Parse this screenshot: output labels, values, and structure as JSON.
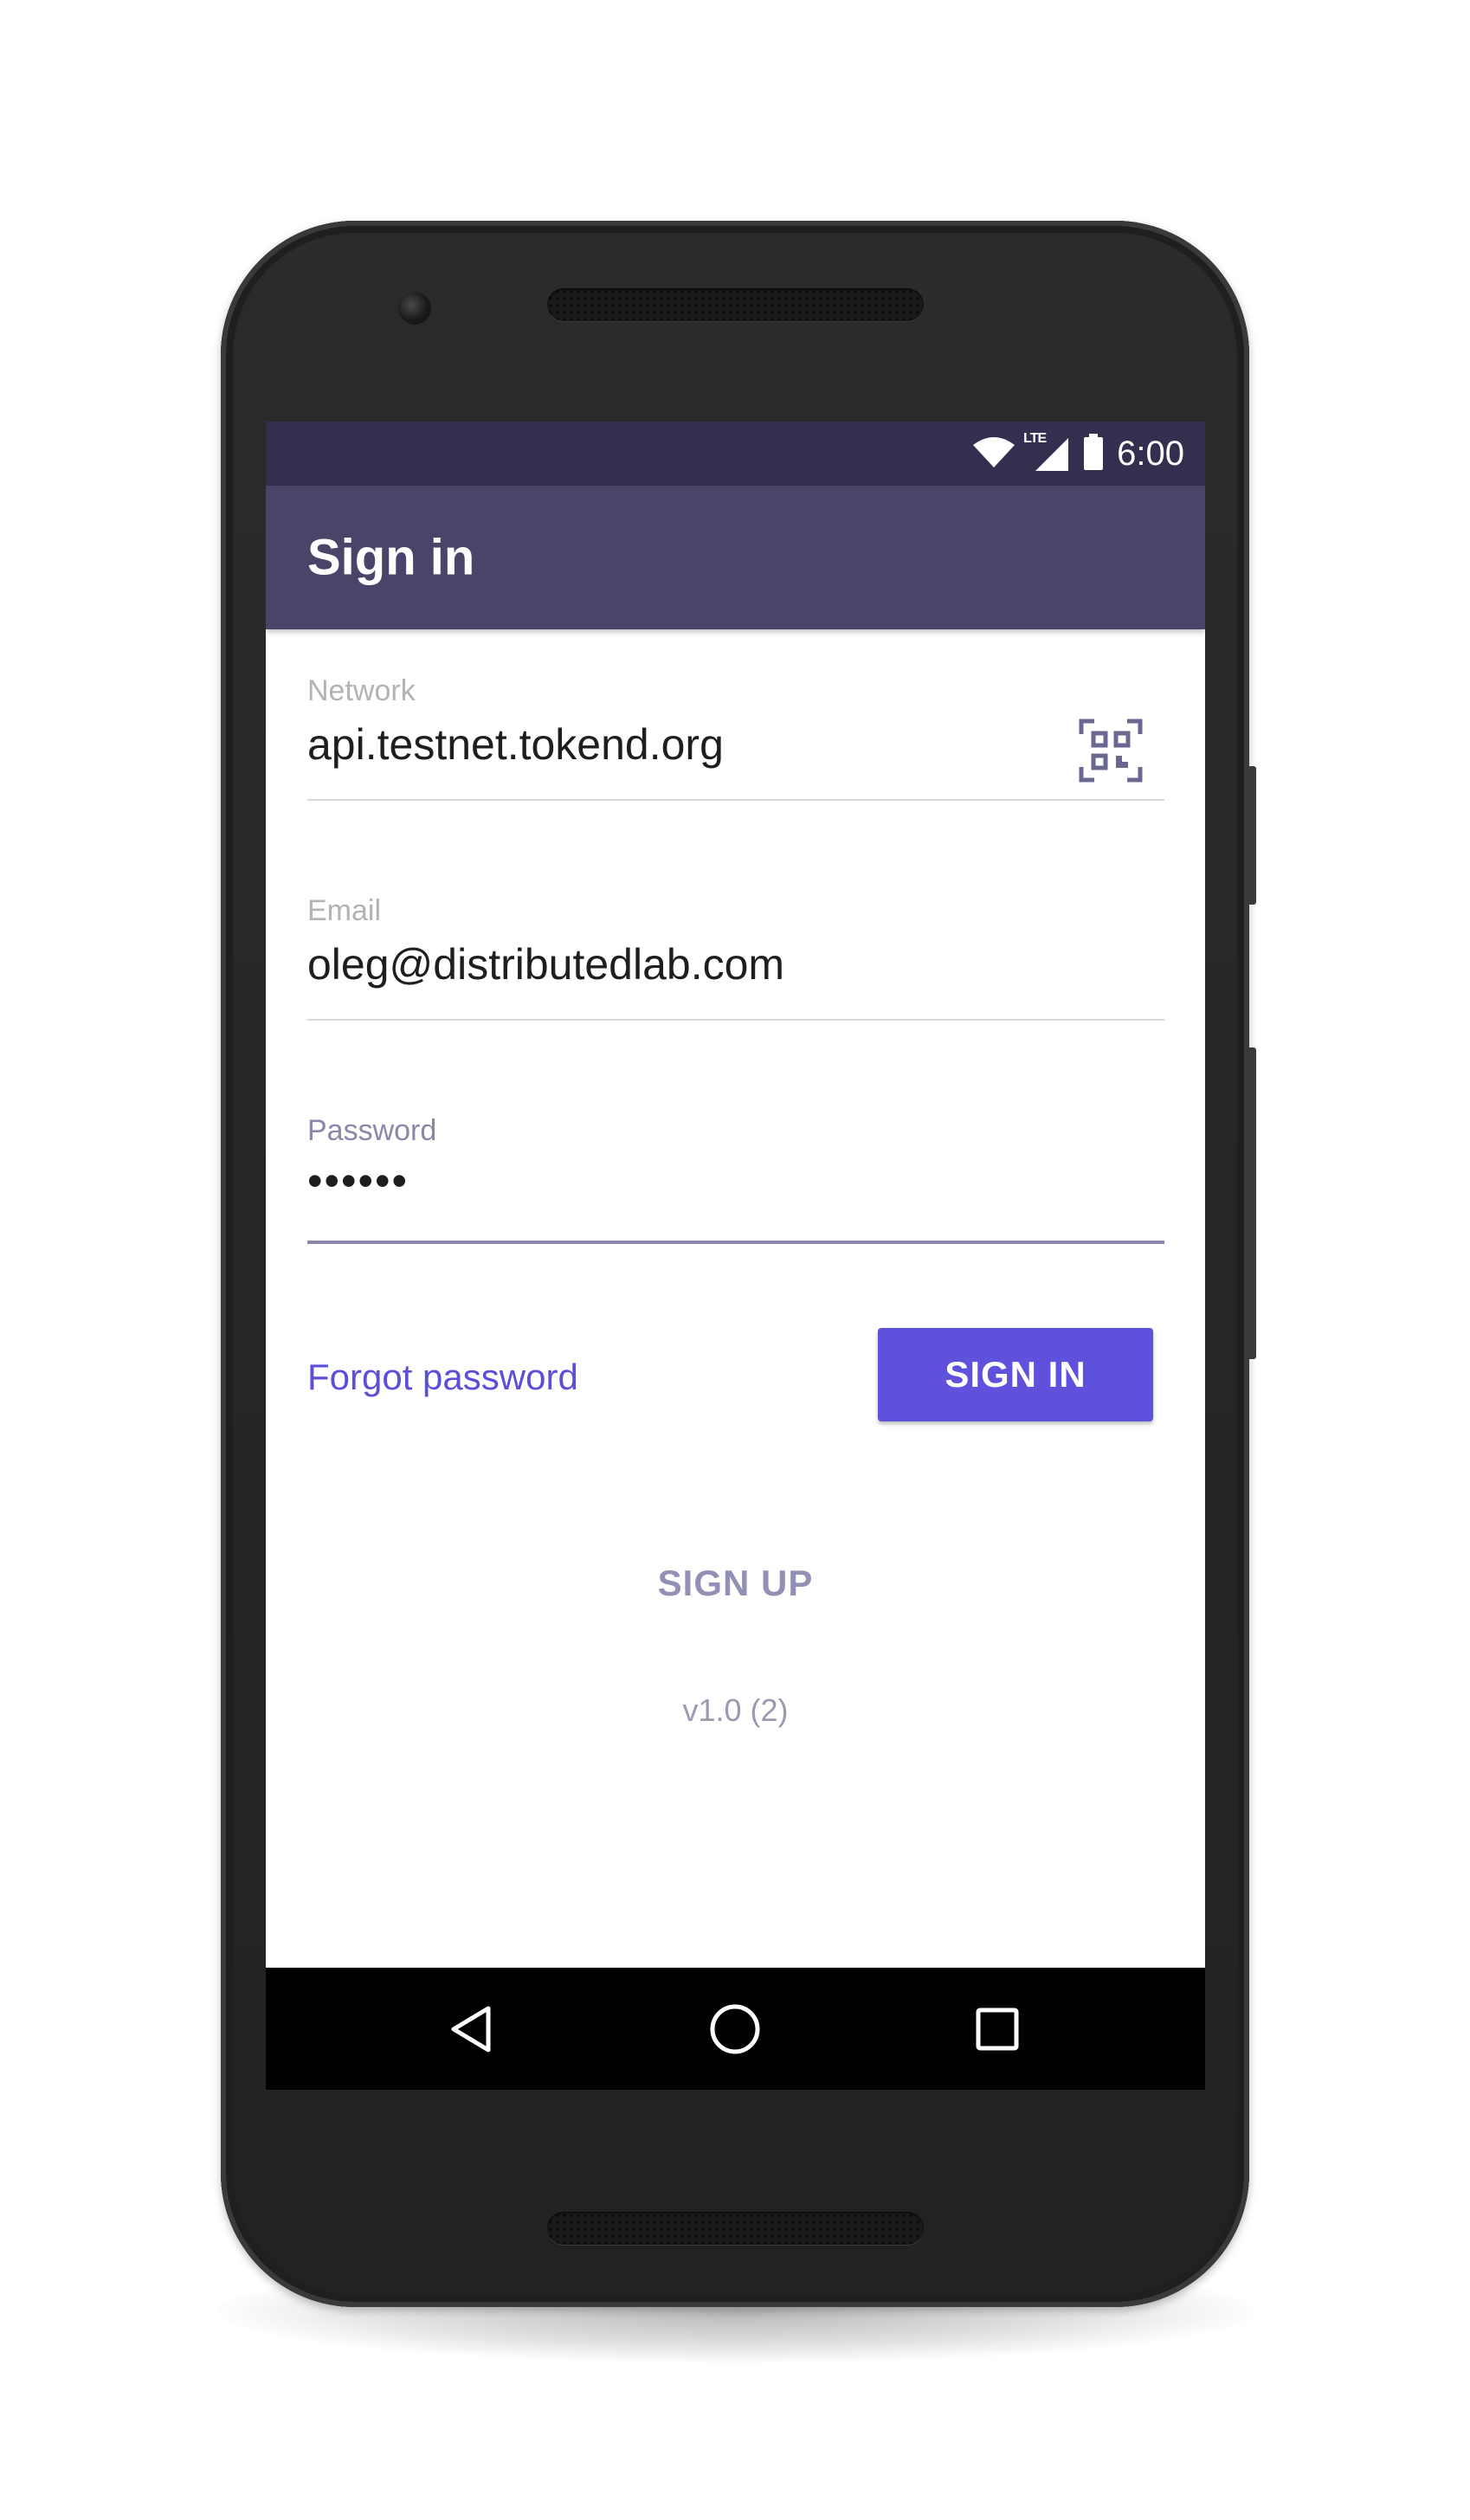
{
  "status_bar": {
    "network_badge": "LTE",
    "time": "6:00",
    "icons": [
      "wifi-icon",
      "cellular-signal-icon",
      "battery-icon"
    ]
  },
  "app_bar": {
    "title": "Sign in"
  },
  "form": {
    "network": {
      "label": "Network",
      "value": "api.testnet.tokend.org",
      "scan_icon": "qr-code-scan-icon"
    },
    "email": {
      "label": "Email",
      "value": "oleg@distributedlab.com"
    },
    "password": {
      "label": "Password",
      "value": "••••••"
    }
  },
  "actions": {
    "forgot_password": "Forgot password",
    "sign_in": "SIGN IN",
    "sign_up": "SIGN UP"
  },
  "version": "v1.0 (2)",
  "nav_bar": {
    "icons": [
      "back-icon",
      "home-icon",
      "recents-icon"
    ]
  },
  "colors": {
    "status_bar": "#33304f",
    "app_bar": "#4a4468",
    "accent": "#5e51dc",
    "link": "#5b4ed8",
    "muted": "#9390b5"
  }
}
